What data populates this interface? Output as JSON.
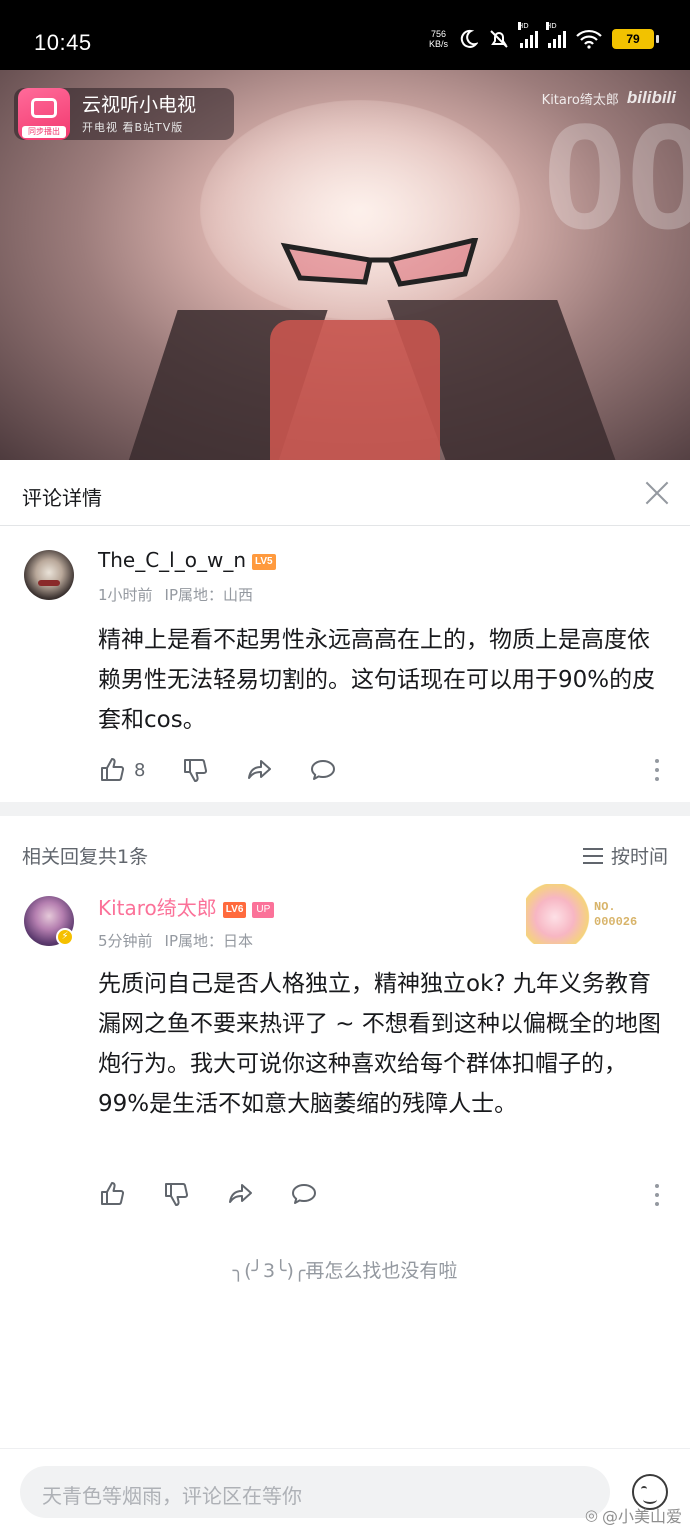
{
  "status_bar": {
    "time": "10:45",
    "net_speed_value": "756",
    "net_speed_unit": "KB/s",
    "signal_label": "HD",
    "battery": "79"
  },
  "video": {
    "ad_title": "云视听小电视",
    "ad_subtitle": "开电视 看B站TV版",
    "ad_logo_tag": "同步播出",
    "watermark_user": "Kitaro绮太郎",
    "watermark_brand": "bilibili"
  },
  "detail": {
    "title": "评论详情"
  },
  "main_comment": {
    "username": "The_C_l_o_w_n",
    "level": "LV5",
    "time": "1小时前",
    "ip": "IP属地：山西",
    "text": "精神上是看不起男性永远高高在上的，物质上是高度依赖男性无法轻易切割的。这句话现在可以用于90%的皮套和cos。",
    "likes": "8"
  },
  "replies": {
    "count_label": "相关回复共1条",
    "sort_label": "按时间"
  },
  "reply": {
    "username": "Kitaro绮太郎",
    "level": "LV6",
    "up_tag": "UP",
    "time": "5分钟前",
    "ip": "IP属地：日本",
    "text": "先质问自己是否人格独立，精神独立ok? 九年义务教育漏网之鱼不要来热评了 ~ 不想看到这种以偏概全的地图炮行为。我大可说你这种喜欢给每个群体扣帽子的，99%是生活不如意大脑萎缩的残障人士。",
    "fan_no": "NO.",
    "fan_number": "000026"
  },
  "list_end": "╮(╯3╰)╭再怎么找也没有啦",
  "input": {
    "placeholder": "天青色等烟雨，评论区在等你"
  },
  "watermark_footer": "@小美山爱",
  "colors": {
    "pink": "#fb7299",
    "text": "#18191c",
    "gray": "#9499a0"
  }
}
